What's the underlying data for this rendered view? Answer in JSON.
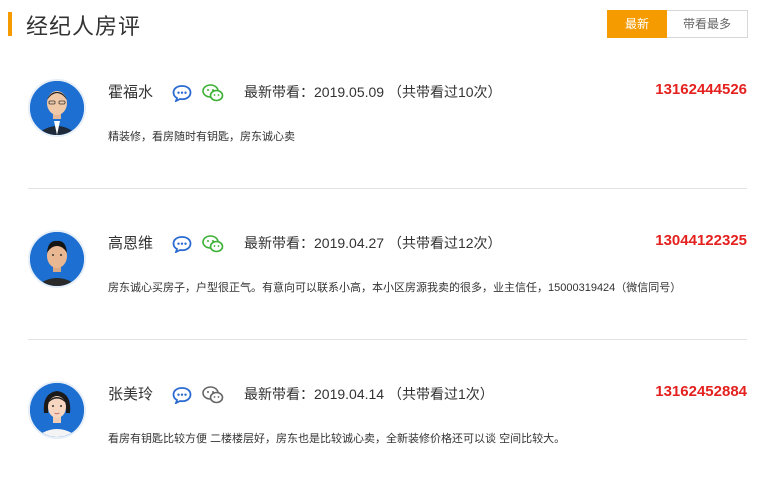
{
  "header": {
    "title": "经纪人房评",
    "tabs": [
      {
        "label": "最新",
        "active": true
      },
      {
        "label": "带看最多",
        "active": false
      }
    ]
  },
  "colors": {
    "accent": "#f59b00",
    "phone": "#e4211e",
    "chat_icon": "#2b6bd1",
    "wechat_icon": "#3cb034"
  },
  "reviews": [
    {
      "name": "霍福水",
      "visit_text": "最新带看：2019.05.09 （共带看过10次）",
      "phone": "13162444526",
      "comment": "精装修，看房随时有钥匙，房东诚心卖",
      "wechat_active": true
    },
    {
      "name": "高恩维",
      "visit_text": "最新带看：2019.04.27 （共带看过12次）",
      "phone": "13044122325",
      "comment": "房东诚心买房子，户型很正气。有意向可以联系小高，本小区房源我卖的很多，业主信任，15000319424（微信同号）",
      "wechat_active": true
    },
    {
      "name": "张美玲",
      "visit_text": "最新带看：2019.04.14 （共带看过1次）",
      "phone": "13162452884",
      "comment": "看房有钥匙比较方便 二楼楼层好，房东也是比较诚心卖，全新装修价格还可以谈 空间比较大。",
      "wechat_active": false
    }
  ]
}
